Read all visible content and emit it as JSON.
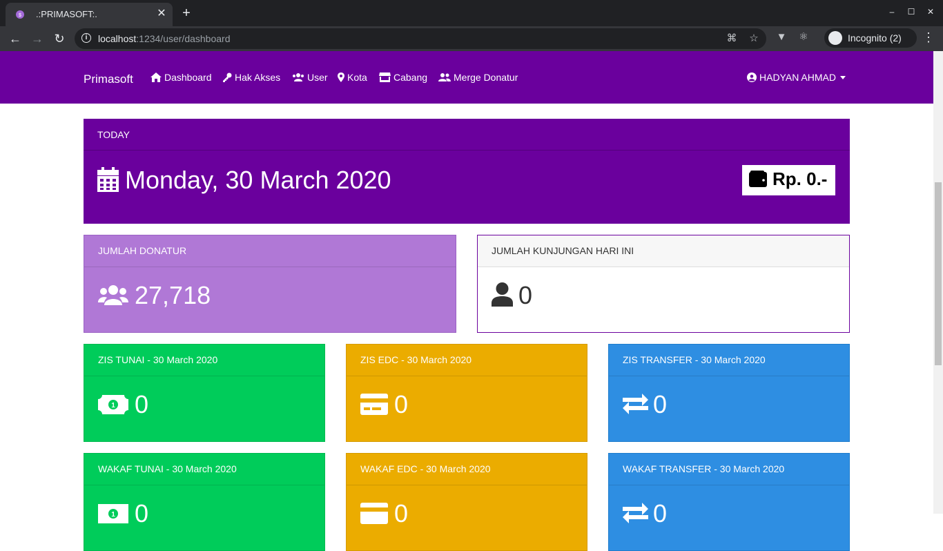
{
  "browser": {
    "tab_title": ".:PRIMASOFT:.",
    "url_host": "localhost",
    "url_path": ":1234/user/dashboard",
    "incognito_label": "Incognito (2)"
  },
  "app": {
    "brand": "Primasoft",
    "nav": [
      {
        "label": "Dashboard",
        "icon": "home-icon"
      },
      {
        "label": "Hak Akses",
        "icon": "key-icon"
      },
      {
        "label": "User",
        "icon": "users-icon"
      },
      {
        "label": "Kota",
        "icon": "map-marker-icon"
      },
      {
        "label": "Cabang",
        "icon": "store-icon"
      },
      {
        "label": "Merge Donatur",
        "icon": "user-friends-icon"
      }
    ],
    "user_name": "HADYAN AHMAD"
  },
  "today": {
    "header": "TODAY",
    "date": "Monday, 30 March 2020",
    "amount": "Rp. 0.-"
  },
  "stats": {
    "donatur": {
      "header": "JUMLAH DONATUR",
      "value": "27,718"
    },
    "kunjungan": {
      "header": "JUMLAH KUNJUNGAN HARI INI",
      "value": "0"
    }
  },
  "zis": [
    {
      "header": "ZIS TUNAI - 30 March 2020",
      "value": "0",
      "icon": "money-bill-icon"
    },
    {
      "header": "ZIS EDC - 30 March 2020",
      "value": "0",
      "icon": "credit-card-icon"
    },
    {
      "header": "ZIS TRANSFER - 30 March 2020",
      "value": "0",
      "icon": "exchange-icon"
    }
  ],
  "wakaf": [
    {
      "header": "WAKAF TUNAI - 30 March 2020",
      "value": "0",
      "icon": "money-bill-icon"
    },
    {
      "header": "WAKAF EDC - 30 March 2020",
      "value": "0",
      "icon": "credit-card-icon"
    },
    {
      "header": "WAKAF TRANSFER - 30 March 2020",
      "value": "0",
      "icon": "exchange-icon"
    }
  ],
  "colors": {
    "primary_purple": "#6a009d",
    "donatur_bg": "#b078d6",
    "green": "#00cc5a",
    "yellow": "#ebac00",
    "blue": "#2e8ee2"
  }
}
